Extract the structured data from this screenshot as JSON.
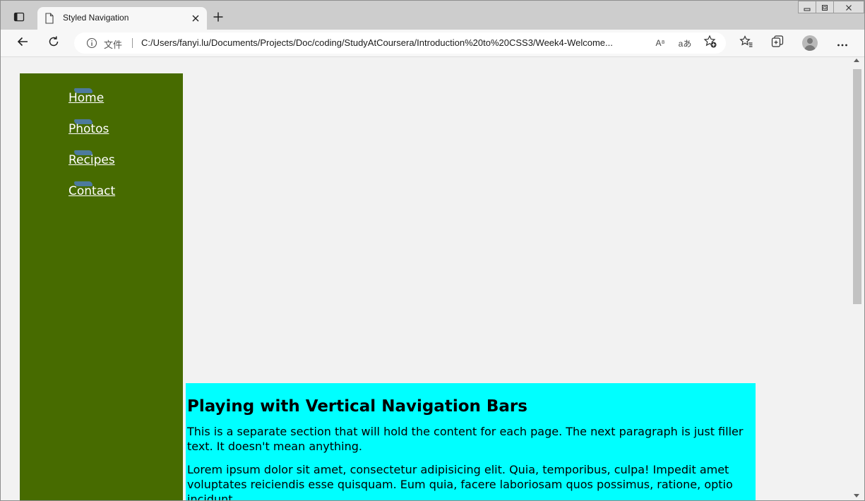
{
  "browser": {
    "tab_title": "Styled Navigation",
    "address_label": "文件",
    "url": "C:/Users/fanyi.lu/Documents/Projects/Doc/coding/StudyAtCoursera/Introduction%20to%20CSS3/Week4-Welcome...",
    "read_aloud_label": "A⁸",
    "translate_label": "aあ"
  },
  "nav": {
    "items": [
      {
        "label": "Home"
      },
      {
        "label": "Photos"
      },
      {
        "label": "Recipes"
      },
      {
        "label": "Contact"
      }
    ]
  },
  "content": {
    "heading": "Playing with Vertical Navigation Bars",
    "paragraph1": "This is a separate section that will hold the content for each page. The next paragraph is just filler text. It doesn't mean anything.",
    "paragraph2": "Lorem ipsum dolor sit amet, consectetur adipisicing elit. Quia, temporibus, culpa! Impedit amet voluptates reiciendis esse quisquam. Eum quia, facere laboriosam quos possimus, ratione, optio incidunt"
  },
  "colors": {
    "nav_background": "#476b00",
    "content_background": "#00ffff",
    "page_background": "#f2f2f2"
  },
  "icons": {
    "tab_actions": "tab-actions-icon",
    "document": "document-icon",
    "close": "close-icon",
    "new_tab": "plus-icon",
    "back": "back-arrow-icon",
    "refresh": "refresh-icon",
    "info": "info-icon",
    "read_aloud": "read-aloud-icon",
    "translate": "translate-icon",
    "add_favorite": "star-add-icon",
    "favorites": "favorites-icon",
    "collections": "collections-icon",
    "profile": "profile-avatar-icon",
    "more": "more-icon"
  }
}
